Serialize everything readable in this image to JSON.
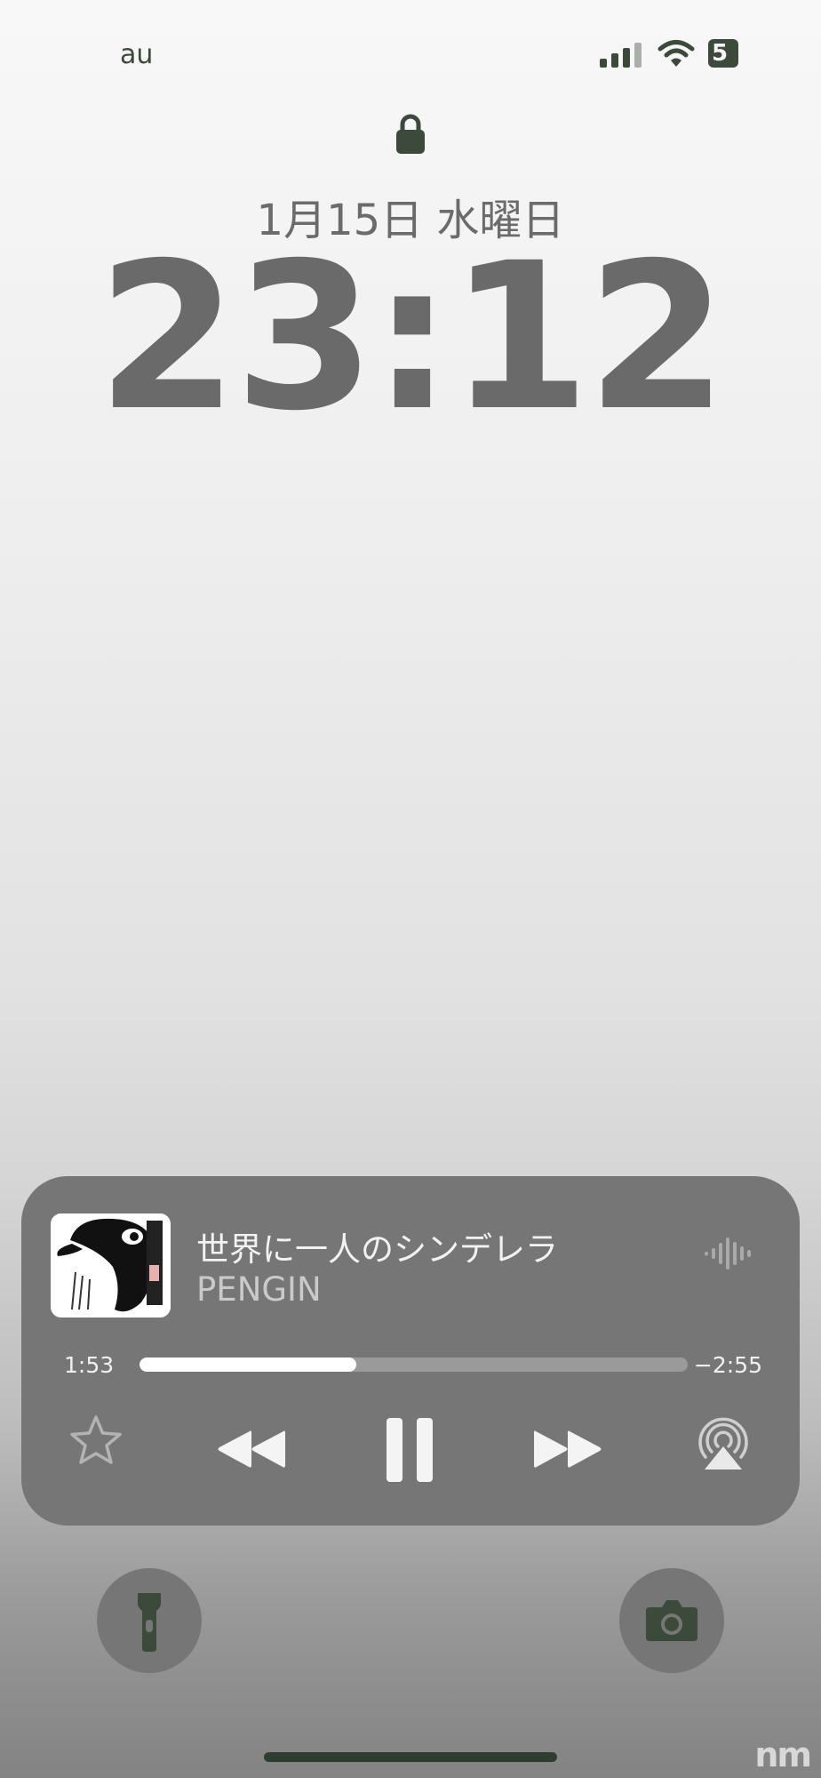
{
  "status_bar": {
    "carrier": "au",
    "battery": "5",
    "signal_bars": 4
  },
  "lock_screen": {
    "date": "1月15日 水曜日",
    "time": "23:12"
  },
  "now_playing": {
    "title": "世界に一人のシンデレラ",
    "artist": "PENGIN",
    "elapsed": "1:53",
    "remaining": "−2:55",
    "progress": 0.395,
    "controls": [
      "favorite-star",
      "rewind",
      "pause",
      "fast-forward",
      "airplay"
    ]
  },
  "quick_actions": [
    "flashlight",
    "camera"
  ],
  "watermark": "nm",
  "colors": {
    "status_icons": "#3c4a3c",
    "clock_text": "#6a6a6a",
    "card_bg": "#767676",
    "progress_fill": "#ffffff"
  }
}
